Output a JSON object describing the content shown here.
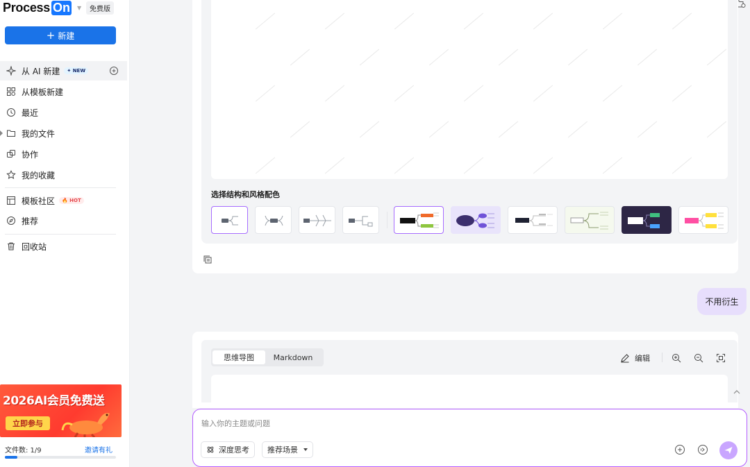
{
  "app": {
    "logo_word": "Process",
    "logo_on": "On",
    "edition": "免费版"
  },
  "sidebar": {
    "new_button": "新建",
    "items": [
      {
        "label": "从 AI 新建",
        "badge": "NEW"
      },
      {
        "label": "从模板新建"
      },
      {
        "label": "最近"
      },
      {
        "label": "我的文件"
      },
      {
        "label": "协作"
      },
      {
        "label": "我的收藏"
      },
      {
        "label": "模板社区",
        "badge": "HOT"
      },
      {
        "label": "推荐"
      },
      {
        "label": "回收站"
      }
    ],
    "promo": {
      "title": "2026AI会员免费送",
      "button": "立即参与"
    },
    "files": {
      "label": "文件数: 1/9",
      "invite": "邀请有礼",
      "progress": 0.11
    }
  },
  "main": {
    "style_section_title": "选择结构和风格配色",
    "user_message": "不用衍生",
    "view_tabs": [
      "思维导图",
      "Markdown"
    ],
    "edit_label": "编辑",
    "input": {
      "placeholder": "输入你的主题或问题",
      "deep_think": "深度思考",
      "scene": "推荐场景"
    }
  },
  "colors": {
    "accent": "#1a73e8",
    "purple": "#b35cff",
    "bubble": "#e7defc"
  }
}
